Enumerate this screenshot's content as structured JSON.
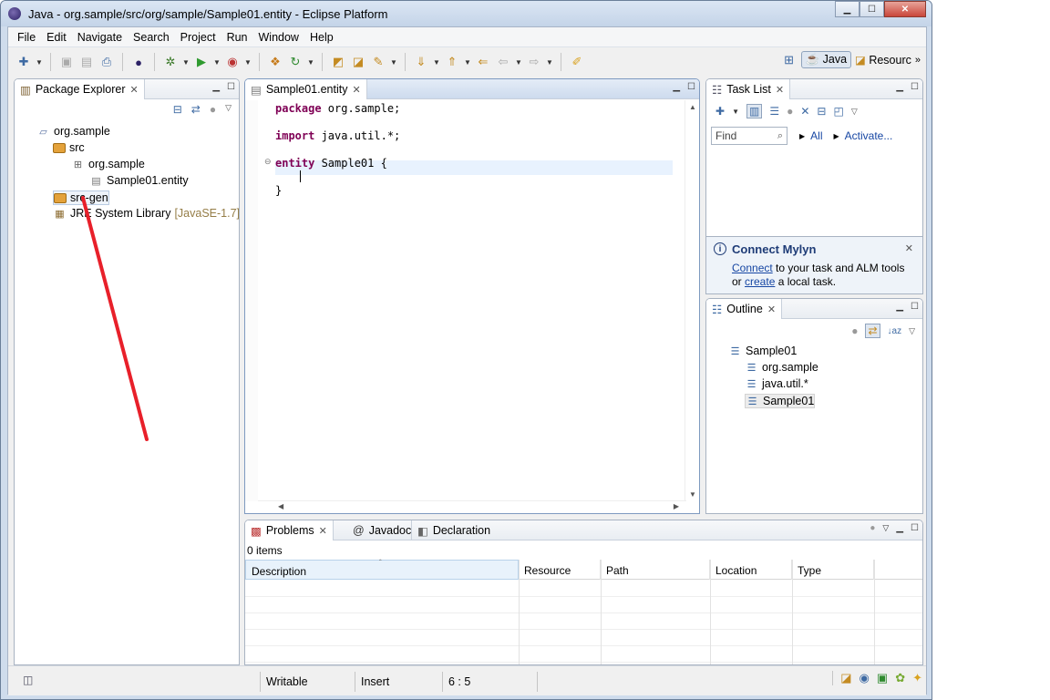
{
  "window": {
    "title": "Java - org.sample/src/org/sample/Sample01.entity - Eclipse Platform",
    "controls": [
      "minimize",
      "maximize",
      "close"
    ]
  },
  "menu": [
    "File",
    "Edit",
    "Navigate",
    "Search",
    "Project",
    "Run",
    "Window",
    "Help"
  ],
  "toolbar": {
    "perspectives": {
      "java": "Java",
      "resource": "Resourc",
      "more": "»"
    }
  },
  "package_explorer": {
    "tab_label": "Package Explorer",
    "items": [
      {
        "label": "org.sample",
        "icon": "project-icon"
      },
      {
        "label": "src",
        "icon": "source-folder-icon"
      },
      {
        "label": "org.sample",
        "icon": "package-icon"
      },
      {
        "label": "Sample01.entity",
        "icon": "file-icon"
      },
      {
        "label": "src-gen",
        "icon": "source-folder-icon"
      },
      {
        "label": "JRE System Library",
        "icon": "library-icon",
        "suffix": "[JavaSE-1.7]"
      }
    ]
  },
  "editor": {
    "tab_label": "Sample01.entity",
    "lines": {
      "l1_kw": "package",
      "l1_rest": " org.sample;",
      "l2_kw": "import",
      "l2_rest": " java.util.*;",
      "l3_kw": "entity",
      "l3_rest": " Sample01 {",
      "l5": "}"
    }
  },
  "task_list": {
    "tab_label": "Task List",
    "find_placeholder": "Find",
    "all_label": "All",
    "activate_label": "Activate..."
  },
  "mylyn": {
    "title": "Connect Mylyn",
    "connect": "Connect",
    "text1": " to your task and ALM tools",
    "or": "or ",
    "create": "create",
    "text2": " a local task."
  },
  "outline": {
    "tab_label": "Outline",
    "items": [
      "Sample01",
      "org.sample",
      "java.util.*",
      "Sample01"
    ]
  },
  "problems": {
    "tabs": [
      "Problems",
      "Javadoc",
      "Declaration"
    ],
    "summary": "0 items",
    "columns": [
      "Description",
      "Resource",
      "Path",
      "Location",
      "Type"
    ]
  },
  "status": {
    "writable": "Writable",
    "insert": "Insert",
    "position": "6 : 5"
  }
}
